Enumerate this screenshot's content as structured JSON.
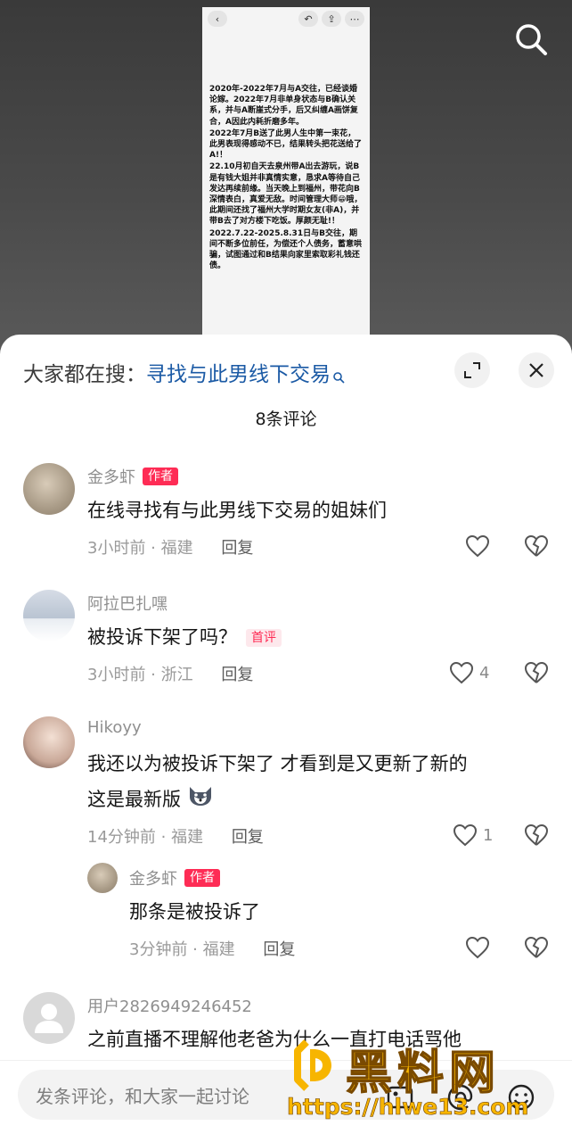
{
  "video": {
    "screenshot_text": [
      "2020年-2022年7月与A交往，已经谈婚论嫁。2022年7月非单身状态与B确认关系，并与A断崖式分手，后又纠缠A画饼复合，A因此内耗折磨多年。",
      "2022年7月B送了此男人生中第一束花，此男表现得感动不已，结果转头把花送给了A!！",
      "22.10月初自天去泉州带A出去游玩，说B是有钱大姐并非真情实意，恳求A等待自己发达再续前缘。当天晚上到福州，带花向B深情表白，真爱无敌。时间管理大师😁哦，此期间还找了福州大学时期女友(非A)，并带B去了对方楼下吃饭。厚颜无耻!！",
      "2022.7.22-2025.8.31日与B交往，期间不断多位前任，为偿还个人债务，蓄意哄骗，试图通过和B结果向家里索取彩礼钱还债。"
    ]
  },
  "header": {
    "search_prefix": "大家都在搜：",
    "search_query": "寻找与此男线下交易",
    "comment_count": "8条评论"
  },
  "comments": [
    {
      "user": "金多虾",
      "badge": "作者",
      "text": "在线寻找有与此男线下交易的姐妹们",
      "meta": "3小时前 · 福建",
      "reply": "回复",
      "likes": ""
    },
    {
      "user": "阿拉巴扎嘿",
      "text": "被投诉下架了吗？",
      "first_badge": "首评",
      "meta": "3小时前 · 浙江",
      "reply": "回复",
      "likes": "4"
    },
    {
      "user": "Hikoyy",
      "text_line1": "我还以为被投诉下架了 才看到是又更新了新的",
      "text_line2": "这是最新版",
      "meta": "14分钟前 · 福建",
      "reply": "回复",
      "likes": "1"
    },
    {
      "user": "金多虾",
      "badge": "作者",
      "text": "那条是被投诉了",
      "meta": "3分钟前 · 福建",
      "reply": "回复",
      "likes": ""
    },
    {
      "user": "用户2826949246452",
      "text": "之前直播不理解他老爸为什么一直打电话骂他"
    }
  ],
  "input": {
    "placeholder": "发条评论，和大家一起讨论"
  },
  "watermark": {
    "title": "黑料网",
    "url": "https://hlwe13.com"
  },
  "colors": {
    "accent": "#fe2c55",
    "link": "#1b5aa5",
    "watermark": "#f7b500"
  }
}
